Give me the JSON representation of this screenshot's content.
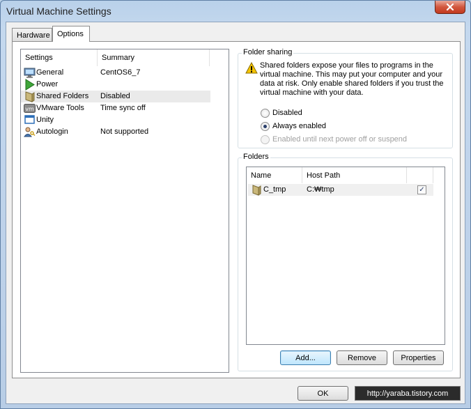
{
  "window": {
    "title": "Virtual Machine Settings"
  },
  "tabs": [
    {
      "label": "Hardware"
    },
    {
      "label": "Options"
    }
  ],
  "settings_list": {
    "headers": {
      "settings": "Settings",
      "summary": "Summary"
    },
    "items": [
      {
        "name": "General",
        "summary": "CentOS6_7",
        "icon": "monitor-icon"
      },
      {
        "name": "Power",
        "summary": "",
        "icon": "play-icon"
      },
      {
        "name": "Shared Folders",
        "summary": "Disabled",
        "icon": "folder-icon"
      },
      {
        "name": "VMware Tools",
        "summary": "Time sync off",
        "icon": "vm-icon"
      },
      {
        "name": "Unity",
        "summary": "",
        "icon": "window-icon"
      },
      {
        "name": "Autologin",
        "summary": "Not supported",
        "icon": "user-key-icon"
      }
    ]
  },
  "folder_sharing": {
    "label": "Folder sharing",
    "description": "Shared folders expose your files to programs in the virtual machine. This may put your computer and your data at risk. Only enable shared folders if you trust the virtual machine with your data.",
    "options": [
      {
        "label": "Disabled",
        "selected": false,
        "enabled": true
      },
      {
        "label": "Always enabled",
        "selected": true,
        "enabled": true
      },
      {
        "label": "Enabled until next power off or suspend",
        "selected": false,
        "enabled": false
      }
    ]
  },
  "folders": {
    "label": "Folders",
    "headers": {
      "name": "Name",
      "host_path": "Host Path"
    },
    "rows": [
      {
        "name": "C_tmp",
        "host_path": "C:₩tmp",
        "checked": "✓"
      }
    ],
    "buttons": {
      "add": "Add...",
      "remove": "Remove",
      "properties": "Properties"
    }
  },
  "footer": {
    "ok": "OK",
    "watermark": "http://yaraba.tistory.com"
  },
  "colors": {
    "accent": "#3c7fb1",
    "warning": "#f5c400"
  }
}
